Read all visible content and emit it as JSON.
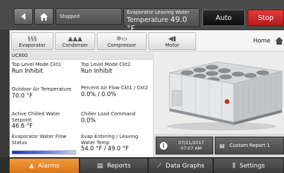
{
  "topbar": {
    "status_text": "Stopped",
    "evap_label": "Evaporator Leaving Water",
    "evap_prefix": "Temperature",
    "evap_value": "49.0 °F",
    "auto_label": "Auto",
    "stop_label": "Stop"
  },
  "nav": {
    "tabs": [
      {
        "label": "Evaporator",
        "icon": "steam-icon"
      },
      {
        "label": "Condenser",
        "icon": "droplets-icon"
      },
      {
        "label": "Compressor",
        "icon": "compressor-icon"
      },
      {
        "label": "Motor",
        "icon": "motor-icon"
      }
    ],
    "home_label": "Home"
  },
  "panel": {
    "header": "UC800",
    "fields": [
      {
        "label": "Top Level Mode Ckt1",
        "value": "Run Inhibit"
      },
      {
        "label": "Top Level Mode Ckt2",
        "value": "Run Inhibit"
      },
      {
        "label": "Outdoor Air Temperature",
        "value": "70.0 °F"
      },
      {
        "label": "Percent Air Flow Ckt1 / Ckt2",
        "value": "0.0% / 0.0%"
      },
      {
        "label": "Active Chilled Water Setpoint",
        "value": "46.6 °F"
      },
      {
        "label": "Chiller Load Command",
        "value": "0.0%"
      },
      {
        "label": "Evaporator Water Flow Status",
        "value": ""
      },
      {
        "label": "Evap Entering / Leaving Water Temp",
        "value": "54.0 °F / 49.0 °F"
      }
    ]
  },
  "info": {
    "date": "07/21/2017",
    "time": "07:07 AM",
    "report_label": "Custom Report 1"
  },
  "bottom_nav": {
    "alarms": "Alarms",
    "reports": "Reports",
    "graphs": "Data Graphs",
    "settings": "Settings"
  },
  "colors": {
    "stop": "#d42a2a",
    "alarms_active": "#ee8a2a",
    "flow_bar": "#1d2eb0"
  }
}
